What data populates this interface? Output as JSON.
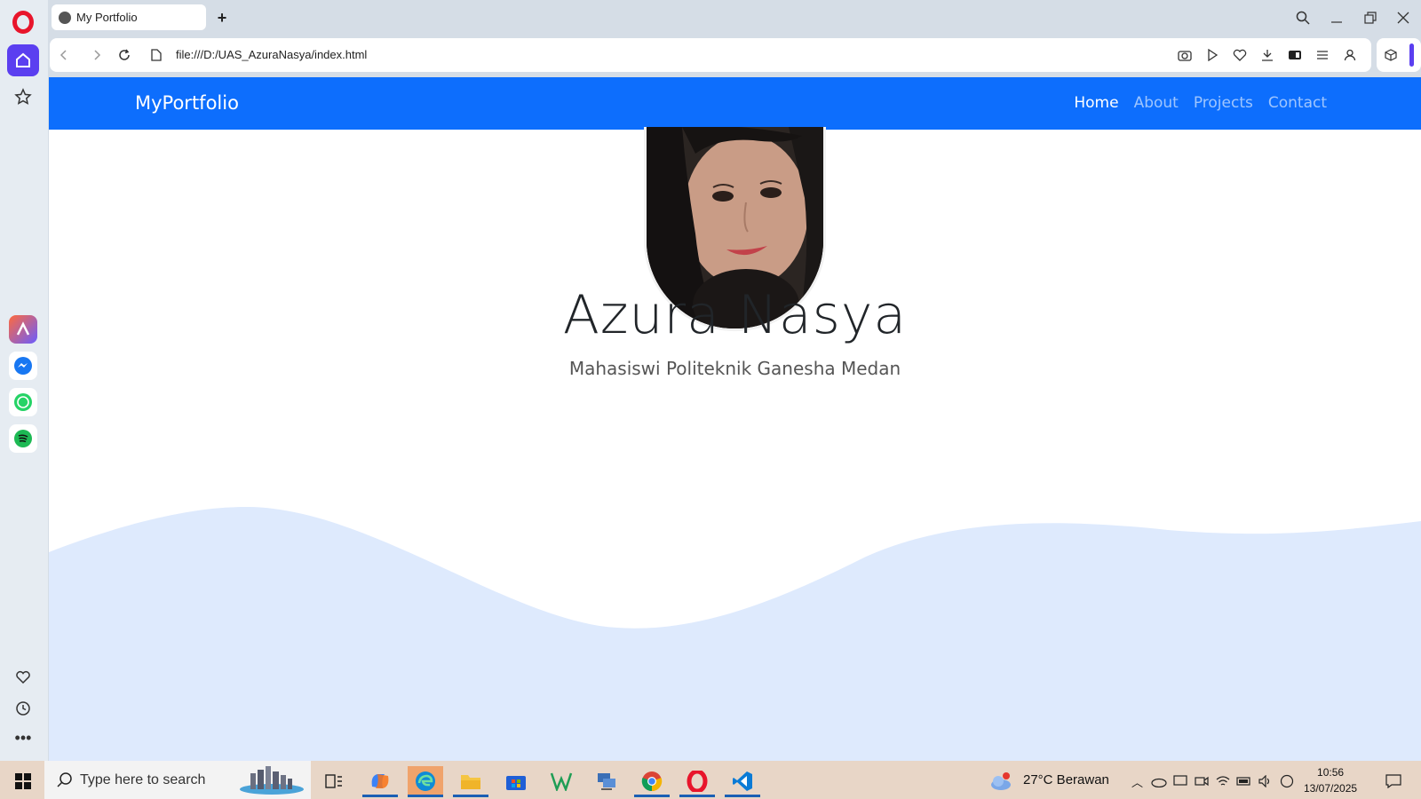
{
  "browser": {
    "tab_title": "My Portfolio",
    "new_tab": "+",
    "url": "file:///D:/UAS_AzuraNasya/index.html"
  },
  "page": {
    "brand": "MyPortfolio",
    "nav": [
      {
        "label": "Home",
        "active": true
      },
      {
        "label": "About",
        "active": false
      },
      {
        "label": "Projects",
        "active": false
      },
      {
        "label": "Contact",
        "active": false
      }
    ],
    "hero_name": "Azura Nasya",
    "hero_subtitle": "Mahasiswi Politeknik Ganesha Medan",
    "colors": {
      "navbar": "#0d6efd",
      "wave": "#deeafd"
    }
  },
  "taskbar": {
    "search_placeholder": "Type here to search",
    "weather": "27°C  Berawan",
    "weather_badge": "1",
    "time": "10:56",
    "date": "13/07/2025"
  }
}
